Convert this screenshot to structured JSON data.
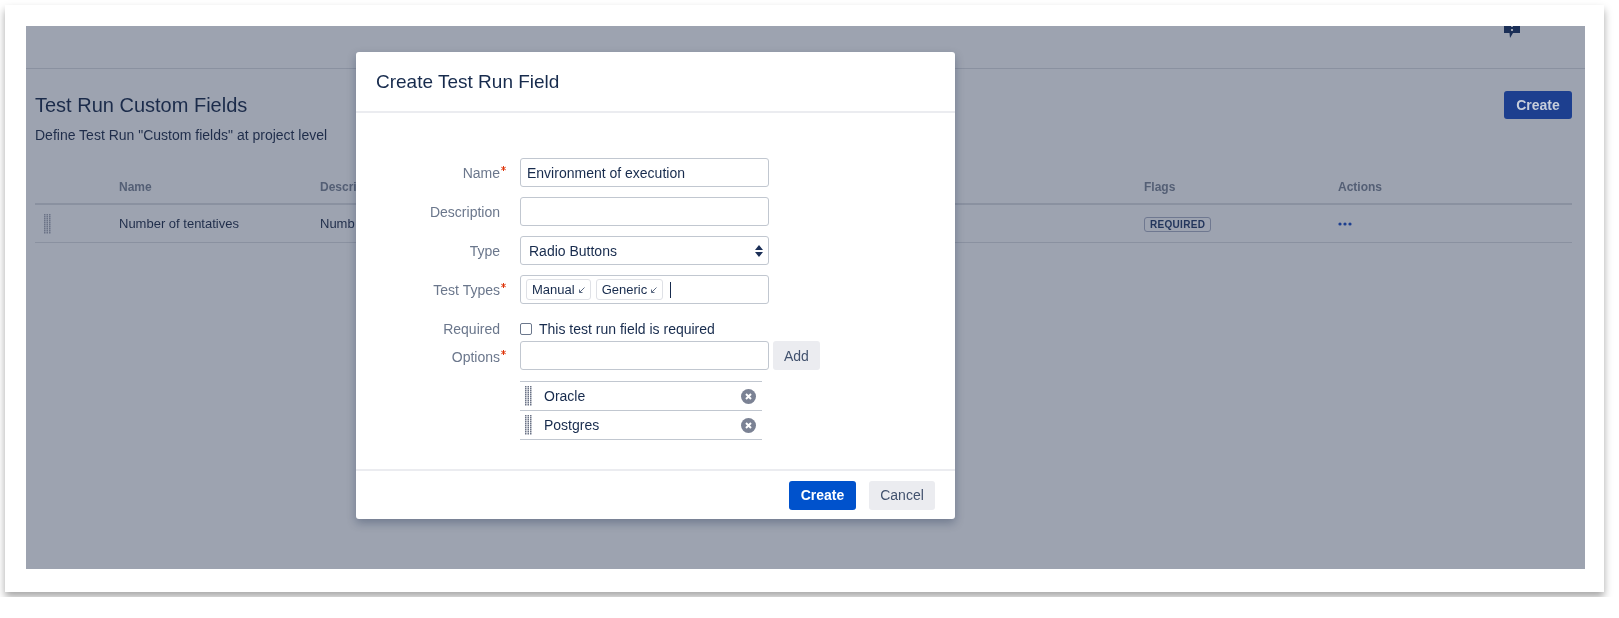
{
  "page": {
    "title": "Test Run Custom Fields",
    "description": "Define Test Run \"Custom fields\" at project level",
    "create_button": "Create"
  },
  "table": {
    "columns": [
      "Name",
      "Descri",
      "Flags",
      "Actions"
    ],
    "rows": [
      {
        "name": "Number of tentatives",
        "column_2": "Numb",
        "flags": [
          "REQUIRED"
        ]
      }
    ]
  },
  "dialog": {
    "title": "Create Test Run Field",
    "fields": [
      {
        "kind": "text",
        "label": "Name",
        "required": true,
        "value": "Environment of execution"
      },
      {
        "kind": "text",
        "label": "Description",
        "required": false
      },
      {
        "kind": "select",
        "label": "Type",
        "required": false,
        "value": "Radio Buttons"
      },
      {
        "kind": "tags",
        "label": "Test Types",
        "required": true,
        "tags": [
          "Manual",
          "Generic"
        ]
      },
      {
        "kind": "checkbox",
        "label": "Required",
        "required": false,
        "checked": false,
        "text": "This test run field is required"
      },
      {
        "kind": "options",
        "label": "Options",
        "required": true,
        "add_button": "Add",
        "options": [
          "Oracle",
          "Postgres"
        ]
      }
    ],
    "buttons": [
      {
        "label": "Create",
        "primary": true
      },
      {
        "label": "Cancel",
        "primary": false
      }
    ]
  }
}
